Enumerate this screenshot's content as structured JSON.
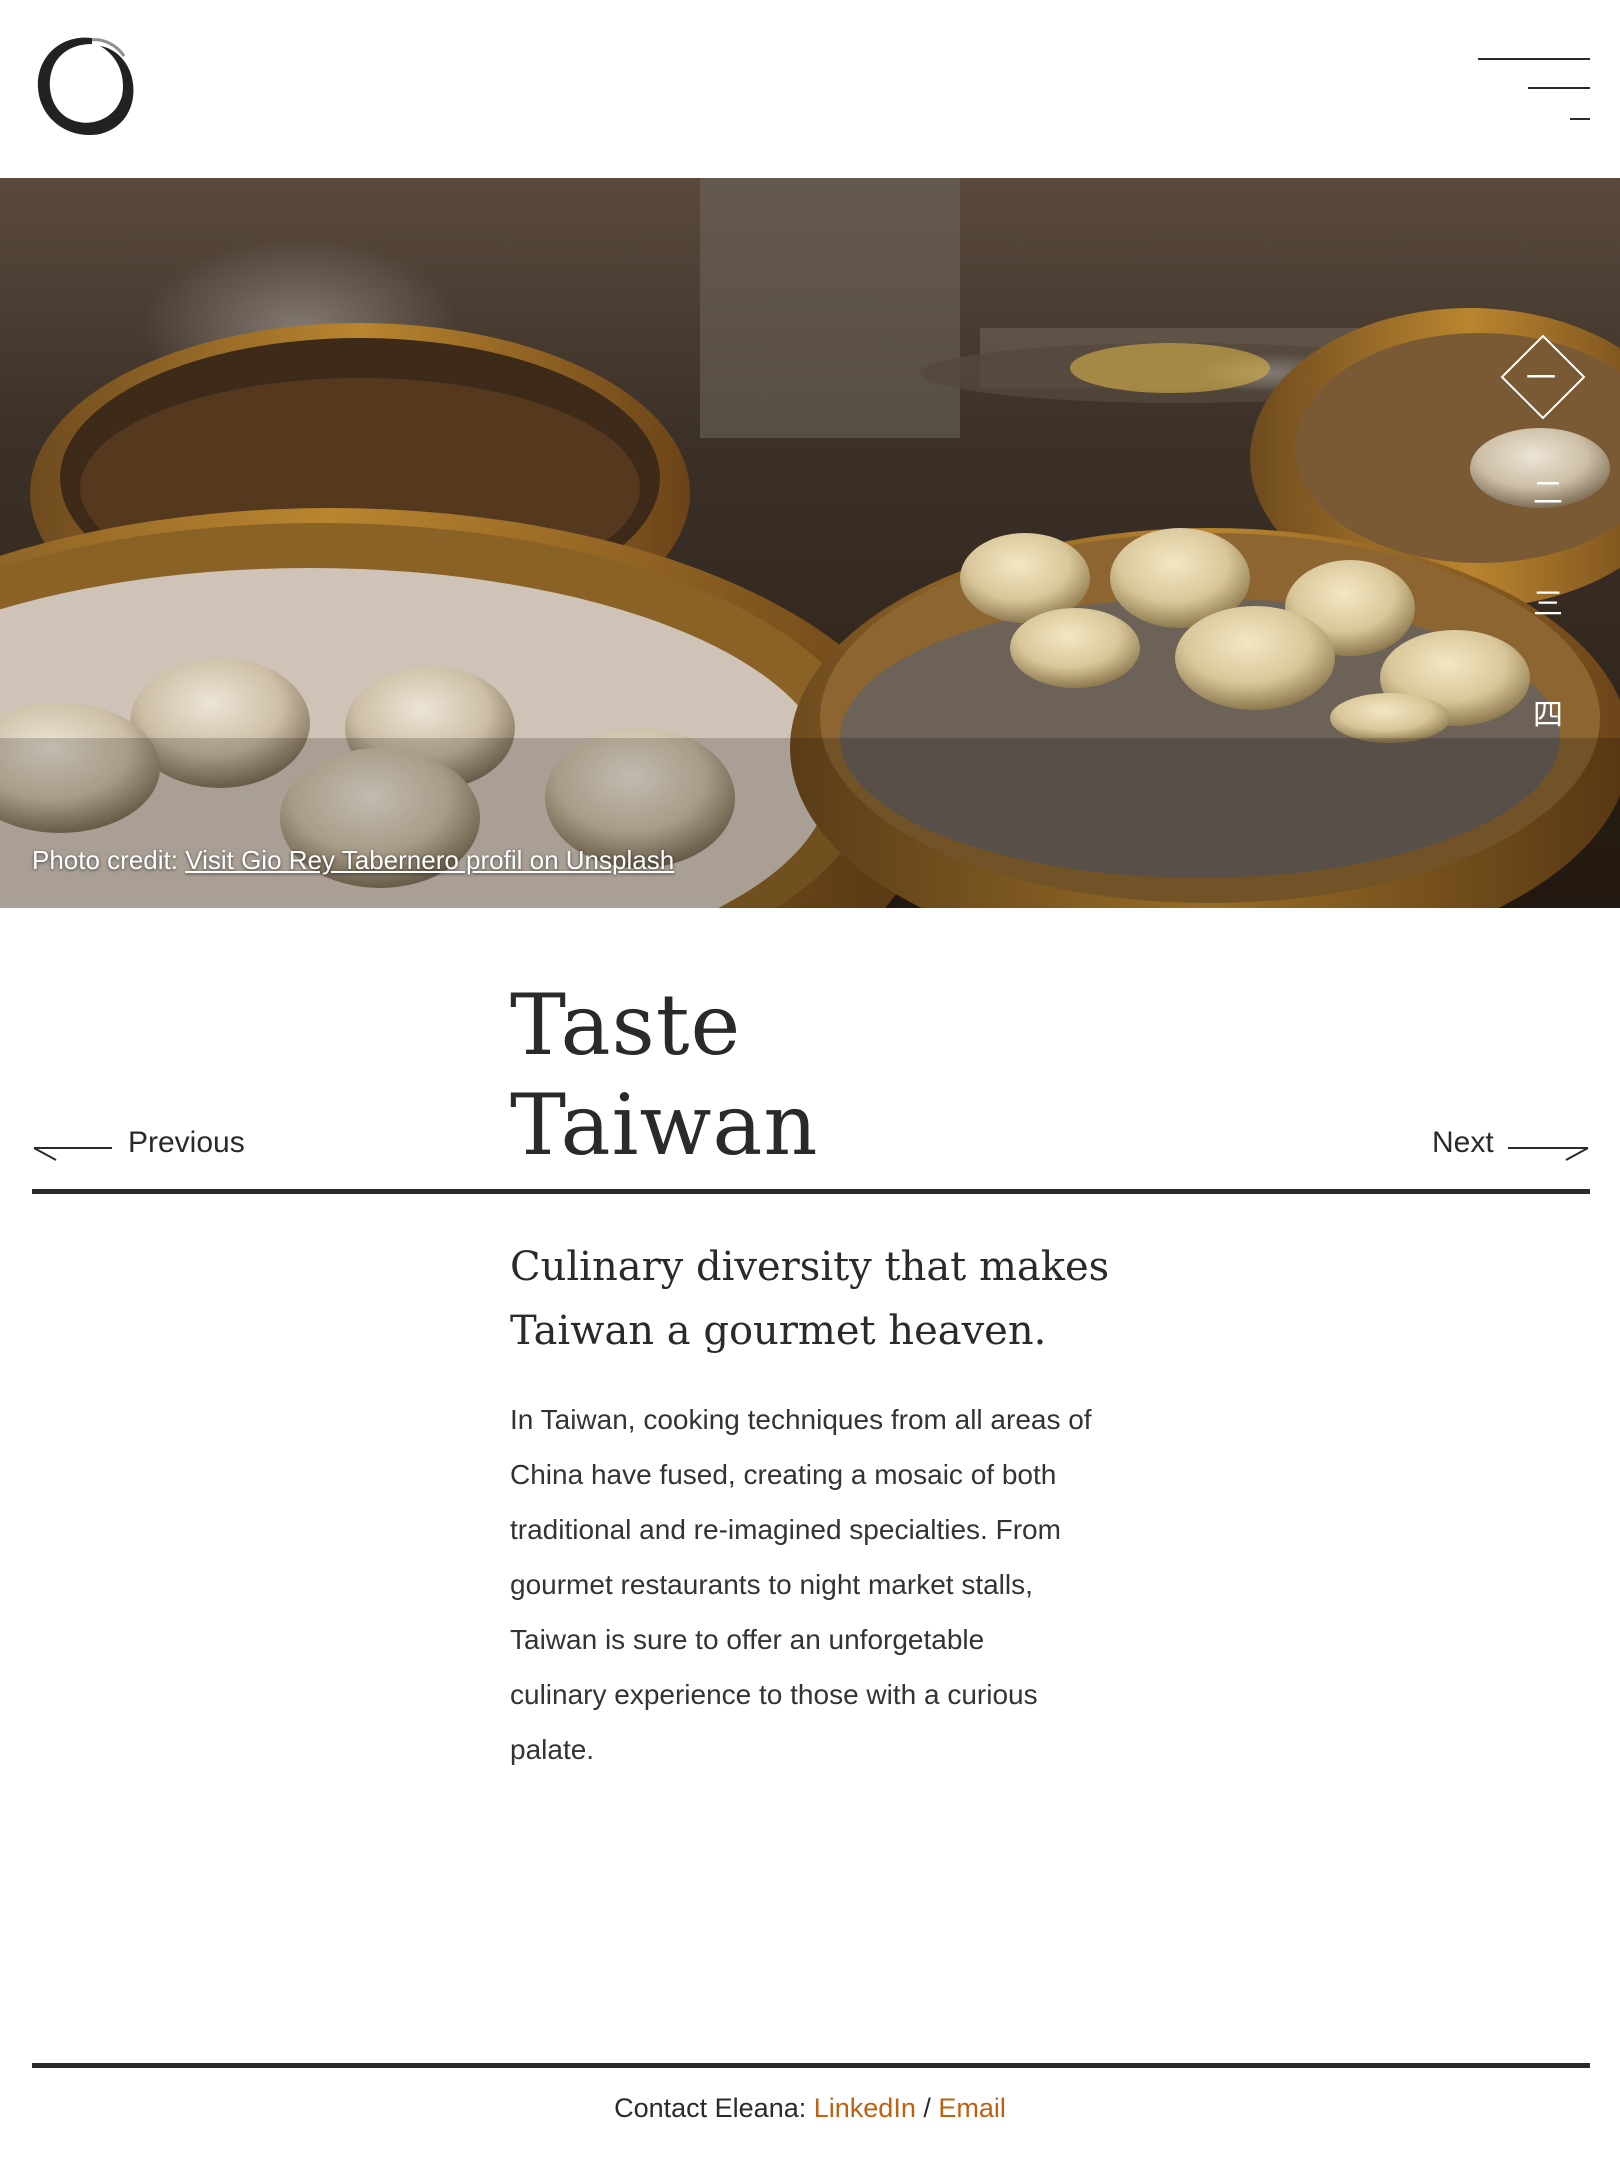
{
  "colors": {
    "text": "#2a2a2a",
    "link_accent": "#c06010",
    "background": "#ffffff"
  },
  "icons": {
    "logo": "enso-circle-icon",
    "menu": "hamburger-lines-icon",
    "previous": "arrow-left-icon",
    "next": "arrow-right-icon"
  },
  "hero": {
    "image_subject": "steamed dumplings in bamboo steamers",
    "credit_prefix": "Photo credit: ",
    "credit_link": "Visit Gio Rey Tabernero profil on Unsplash"
  },
  "side_nav": {
    "items": [
      "一",
      "二",
      "三",
      "四"
    ]
  },
  "title": {
    "line1": "Taste",
    "line2": "Taiwan"
  },
  "nav": {
    "previous": "Previous",
    "next": "Next"
  },
  "subtitle": {
    "line1": "Culinary diversity that makes",
    "line2": "Taiwan a gourmet heaven."
  },
  "body": {
    "lines": [
      "In Taiwan, cooking techniques from all areas of",
      "China have fused, creating a mosaic of both",
      "traditional and re-imagined specialties. From",
      "gourmet restaurants to night market stalls,",
      "Taiwan is sure to offer an unforgetable",
      "culinary experience to those with a curious",
      "palate."
    ]
  },
  "footer": {
    "prefix": "Contact Eleana: ",
    "linkedin": "LinkedIn",
    "separator": " / ",
    "email": "Email"
  }
}
